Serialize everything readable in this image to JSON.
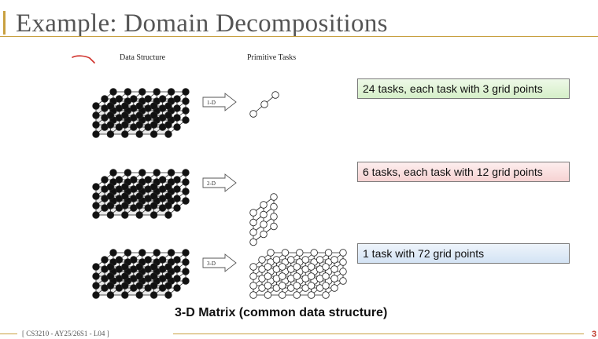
{
  "slide": {
    "title": "Example: Domain Decompositions",
    "header_data_structure": "Data Structure",
    "header_primitive_tasks": "Primitive Tasks",
    "caption": "3-D Matrix (common data structure)",
    "footer": "[ CS3210 - AY25/26S1 - L04 ]",
    "page_number": "3"
  },
  "rows": [
    {
      "arrow_label": "1-D",
      "description": "24 tasks, each task with 3 grid points",
      "color": "#dff2d4"
    },
    {
      "arrow_label": "2-D",
      "description": "6 tasks, each task with 12 grid points",
      "color": "#f9dede"
    },
    {
      "arrow_label": "3-D",
      "description": "1 task with 72 grid points",
      "color": "#dde8f5"
    }
  ],
  "colors": {
    "accent": "#c8a040",
    "annotation": "#d0302a"
  }
}
